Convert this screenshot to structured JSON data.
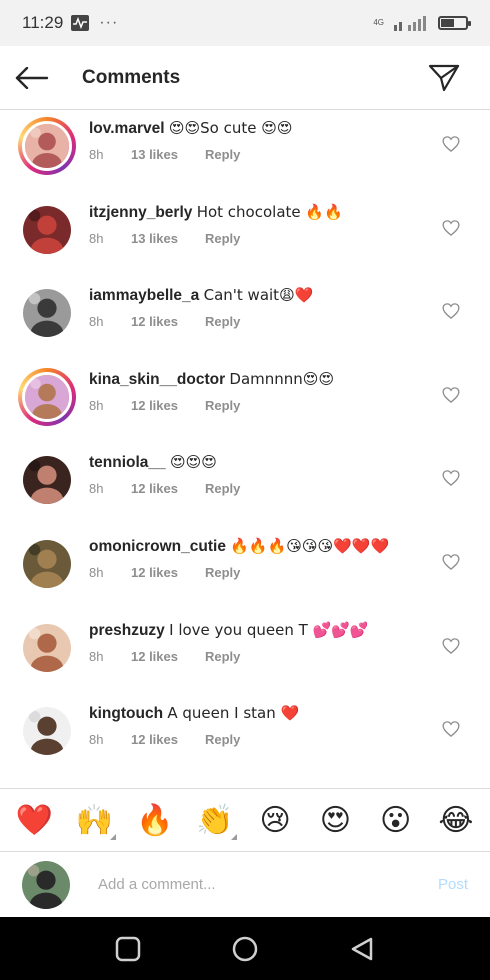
{
  "status_bar": {
    "time": "11:29",
    "more": "···",
    "network": "4G",
    "battery_level": 0.55
  },
  "header": {
    "title": "Comments",
    "back_icon": "arrow-left-icon",
    "share_icon": "paper-plane-icon"
  },
  "comments": [
    {
      "user": "lov.marvel",
      "text": "😍😍So cute 😍😍",
      "time": "8h",
      "likes": "13 likes",
      "reply": "Reply",
      "story_ring": true,
      "avatar_colors": [
        "#e8b3a6",
        "#b35a5a",
        "#f4d8cc"
      ]
    },
    {
      "user": "itzjenny_berly",
      "text": "Hot chocolate 🔥🔥",
      "time": "8h",
      "likes": "13 likes",
      "reply": "Reply",
      "story_ring": false,
      "avatar_colors": [
        "#7a2a2a",
        "#c2403a",
        "#3a1414"
      ]
    },
    {
      "user": "iammaybelle_a",
      "text": "Can't wait😩❤️",
      "time": "8h",
      "likes": "12 likes",
      "reply": "Reply",
      "story_ring": false,
      "avatar_colors": [
        "#9a9a9a",
        "#3a3a3a",
        "#e0e0e0"
      ]
    },
    {
      "user": "kina_skin__doctor",
      "text": "Damnnnn😍😍",
      "time": "8h",
      "likes": "12 likes",
      "reply": "Reply",
      "story_ring": true,
      "avatar_colors": [
        "#d9a7d6",
        "#b57a5a",
        "#f0d0e8"
      ]
    },
    {
      "user": "tenniola__",
      "text": "😍😍😍",
      "time": "8h",
      "likes": "12 likes",
      "reply": "Reply",
      "story_ring": false,
      "avatar_colors": [
        "#3a2420",
        "#c08070",
        "#1a1010"
      ]
    },
    {
      "user": "omonicrown_cutie",
      "text": "🔥🔥🔥😘😘😘❤️❤️❤️",
      "time": "8h",
      "likes": "12 likes",
      "reply": "Reply",
      "story_ring": false,
      "avatar_colors": [
        "#6a5a3a",
        "#a08050",
        "#2a2a1a"
      ]
    },
    {
      "user": "preshzuzy",
      "text": "I love you queen T 💕💕💕",
      "time": "8h",
      "likes": "12 likes",
      "reply": "Reply",
      "story_ring": false,
      "avatar_colors": [
        "#e8c8b0",
        "#b0684a",
        "#f6e8dc"
      ]
    },
    {
      "user": "kingtouch",
      "text": "A queen I stan ❤️",
      "time": "8h",
      "likes": "12 likes",
      "reply": "Reply",
      "story_ring": false,
      "avatar_colors": [
        "#f0f0f0",
        "#5a4030",
        "#cfcfcf"
      ]
    }
  ],
  "reactions": [
    {
      "emoji": "❤️",
      "name": "heart",
      "tone": false
    },
    {
      "emoji": "🙌",
      "name": "raising-hands",
      "tone": true
    },
    {
      "emoji": "🔥",
      "name": "fire",
      "tone": false
    },
    {
      "emoji": "👏",
      "name": "clapping-hands",
      "tone": true
    },
    {
      "emoji": "😢",
      "name": "crying-face",
      "tone": false
    },
    {
      "emoji": "😍",
      "name": "heart-eyes",
      "tone": false
    },
    {
      "emoji": "😮",
      "name": "surprised-face",
      "tone": false
    },
    {
      "emoji": "😂",
      "name": "tears-of-joy",
      "tone": false
    }
  ],
  "composer": {
    "placeholder": "Add a comment...",
    "post_label": "Post",
    "avatar_colors": [
      "#6a8a6a",
      "#2a2a2a",
      "#c0b0a0"
    ]
  },
  "colors": {
    "accent_blue_disabled": "#b3dbff",
    "text_primary": "#262626",
    "text_secondary": "#8e8e8e",
    "divider": "#dbdbdb"
  }
}
